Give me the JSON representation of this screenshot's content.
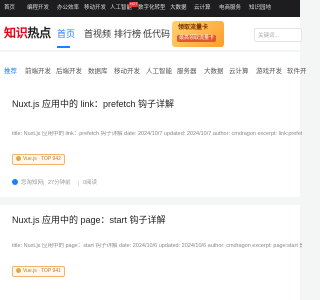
{
  "topbar": {
    "items": [
      "首页",
      "编程开发",
      "办公效率",
      "移动开发",
      "人工智能",
      "数字化转型",
      "大数据",
      "云计算",
      "电商服务",
      "知识园地"
    ],
    "hot_badge": "HOT"
  },
  "header": {
    "logo_part1": "知识",
    "logo_part2": "热点",
    "nav": [
      "首页",
      "首视频",
      "排行榜",
      "低代码"
    ],
    "ad_line1": "领取流量卡",
    "ad_line2": "最高领取流量卡",
    "search_placeholder": "关键词..."
  },
  "categories": [
    "推荐",
    "前端开发",
    "后端开发",
    "数据库",
    "移动开发",
    "人工智能",
    "服务器",
    "大数据",
    "云计算",
    "游戏开发",
    "软件开"
  ],
  "articles": [
    {
      "title": "Nuxt.js 应用中的 link：prefetch 钩子详解",
      "excerpt": "title: Nuxt.js 应用中的 link：prefetch 钩子详解 date: 2024/10/7 updated: 2024/10/7 author: cmdragon excerpt: link:prefetch 是一个强",
      "tag": "Vue.js · TOP 942",
      "author": "您淘知网",
      "read_time": "27分钟前",
      "views": "0阅读"
    },
    {
      "title": "Nuxt.js 应用中的 page：start 钩子详解",
      "excerpt": "title: Nuxt.js 应用中的 page：start 钩子详解 date: 2024/10/6 updated: 2024/10/6 author: cmdragon excerpt: page:start 是一个钩子，",
      "tag": "Vue.js · TOP 941",
      "author": "",
      "read_time": "",
      "views": ""
    }
  ]
}
